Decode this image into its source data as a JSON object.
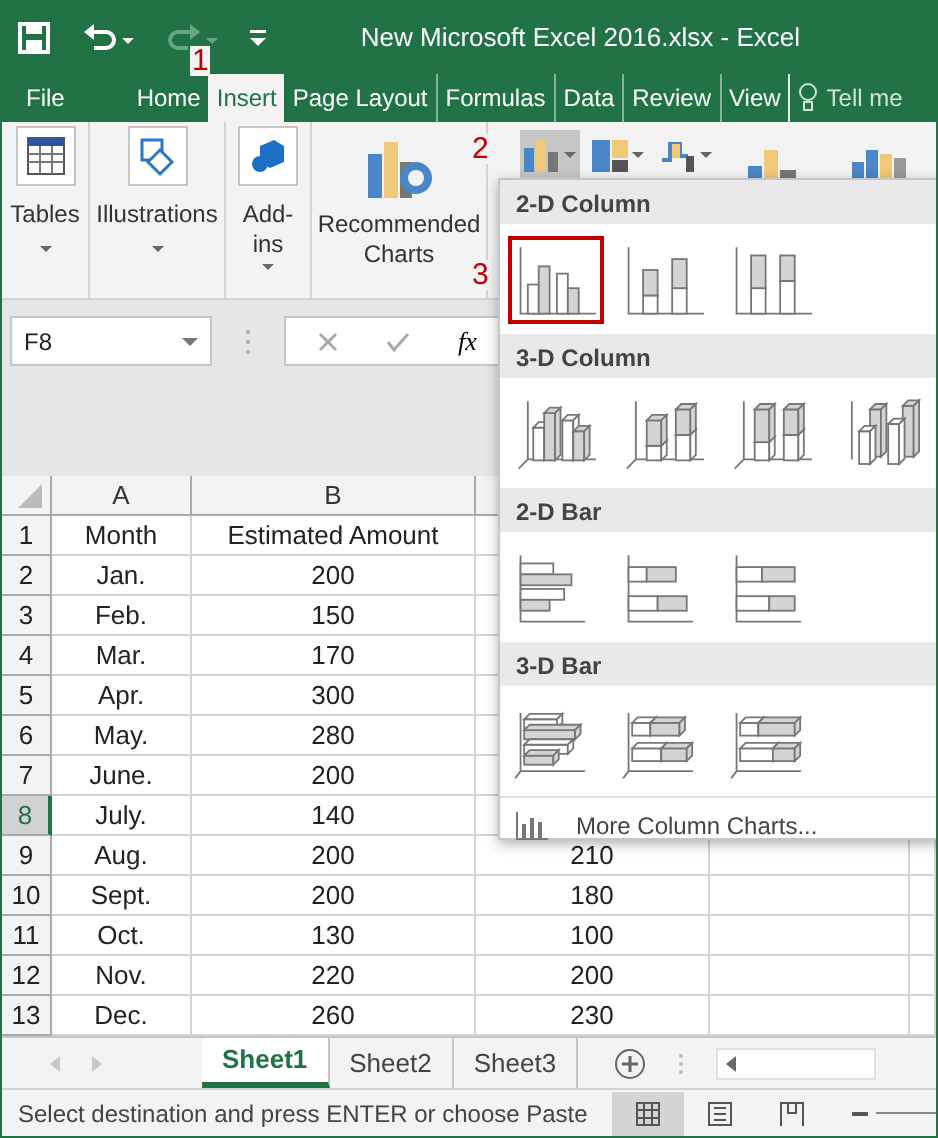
{
  "title_bar": {
    "title": "New Microsoft Excel 2016.xlsx - Excel"
  },
  "ribbon_tabs": [
    {
      "label": "File",
      "selected": false
    },
    {
      "label": "Home",
      "selected": false
    },
    {
      "label": "Insert",
      "selected": true
    },
    {
      "label": "Page Layout",
      "selected": false
    },
    {
      "label": "Formulas",
      "selected": false
    },
    {
      "label": "Data",
      "selected": false
    },
    {
      "label": "Review",
      "selected": false
    },
    {
      "label": "View",
      "selected": false
    }
  ],
  "tell_me": "Tell me",
  "ribbon_groups": [
    {
      "kind": "tables",
      "label": "Tables"
    },
    {
      "kind": "illustrations",
      "label": "Illustrations"
    },
    {
      "kind": "addins",
      "label": "Add-ins"
    },
    {
      "kind": "recommended",
      "label": "Recommended Charts"
    }
  ],
  "chart_buttons": [
    {
      "kind": "column",
      "pressed": true
    },
    {
      "kind": "hierarchy",
      "pressed": false
    },
    {
      "kind": "waterfall",
      "pressed": false
    }
  ],
  "annotations": [
    "1",
    "2",
    "3"
  ],
  "formula_bar": {
    "name_box": "F8",
    "function_label": "fx"
  },
  "sheet": {
    "column_headers": [
      "A",
      "B"
    ],
    "rows": [
      {
        "number": "1",
        "selected": false,
        "month": "Month",
        "amount": "Estimated Amount"
      },
      {
        "number": "2",
        "selected": false,
        "month": "Jan.",
        "amount": "200"
      },
      {
        "number": "3",
        "selected": false,
        "month": "Feb.",
        "amount": "150"
      },
      {
        "number": "4",
        "selected": false,
        "month": "Mar.",
        "amount": "170"
      },
      {
        "number": "5",
        "selected": false,
        "month": "Apr.",
        "amount": "300"
      },
      {
        "number": "6",
        "selected": false,
        "month": "May.",
        "amount": "280"
      },
      {
        "number": "7",
        "selected": false,
        "month": "June.",
        "amount": "200"
      },
      {
        "number": "8",
        "selected": true,
        "month": "July.",
        "amount": "140"
      },
      {
        "number": "9",
        "selected": false,
        "month": "Aug.",
        "amount": "200",
        "column_3": "210"
      },
      {
        "number": "10",
        "selected": false,
        "month": "Sept.",
        "amount": "200",
        "column_3": "180"
      },
      {
        "number": "11",
        "selected": false,
        "month": "Oct.",
        "amount": "130",
        "column_3": "100"
      },
      {
        "number": "12",
        "selected": false,
        "month": "Nov.",
        "amount": "220",
        "column_3": "200"
      },
      {
        "number": "13",
        "selected": false,
        "month": "Dec.",
        "amount": "260",
        "column_3": "230"
      }
    ]
  },
  "chart_menu": {
    "sections": [
      {
        "title": "2-D Column",
        "options": [
          {
            "kind": "clusteredcolumn",
            "highlighted": true
          },
          {
            "kind": "stackedcolumn",
            "highlighted": false
          },
          {
            "kind": "percentcolumn",
            "highlighted": false
          }
        ]
      },
      {
        "title": "3-D Column",
        "options": [
          {
            "kind": "clustered3dcolumn",
            "highlighted": false
          },
          {
            "kind": "stacked3dcolumn",
            "highlighted": false
          },
          {
            "kind": "percent3dcolumn",
            "highlighted": false
          },
          {
            "kind": "column3d",
            "highlighted": false
          }
        ]
      },
      {
        "title": "2-D Bar",
        "options": [
          {
            "kind": "clusteredbar",
            "highlighted": false
          },
          {
            "kind": "stackedbar",
            "highlighted": false
          },
          {
            "kind": "percentbar",
            "highlighted": false
          }
        ]
      },
      {
        "title": "3-D Bar",
        "options": [
          {
            "kind": "clustered3dbar",
            "highlighted": false
          },
          {
            "kind": "stacked3dbar",
            "highlighted": false
          },
          {
            "kind": "percent3dbar",
            "highlighted": false
          }
        ]
      }
    ],
    "more": "More Column Charts..."
  },
  "sheet_tabs": [
    {
      "label": "Sheet1",
      "selected": true
    },
    {
      "label": "Sheet2",
      "selected": false
    },
    {
      "label": "Sheet3",
      "selected": false
    }
  ],
  "status_bar": {
    "message": "Select destination and press ENTER or choose Paste"
  }
}
